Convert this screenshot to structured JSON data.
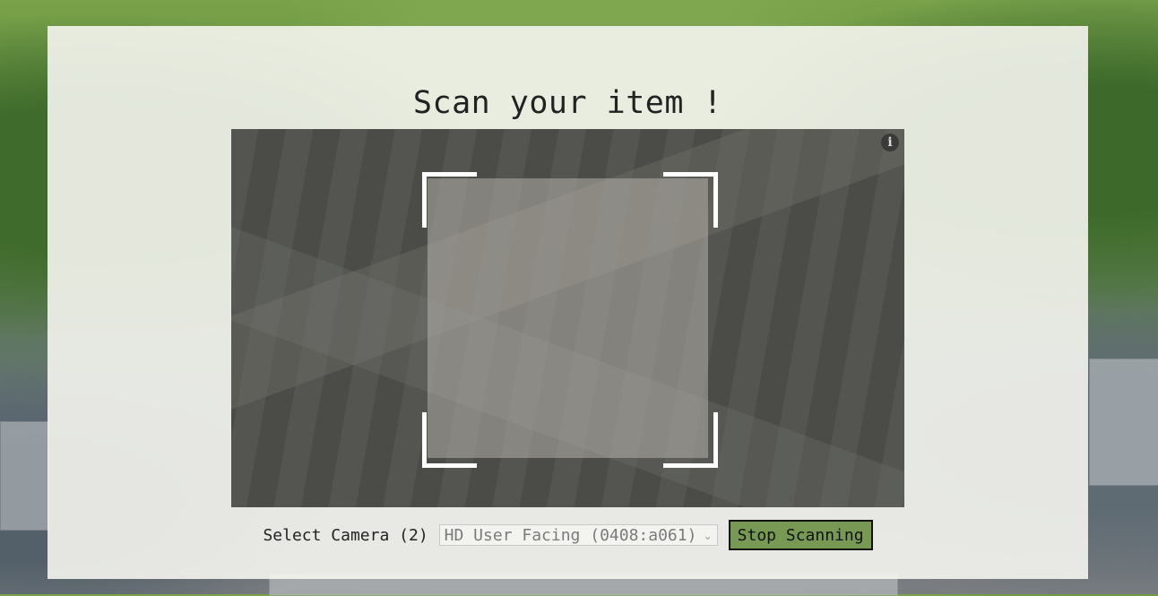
{
  "page": {
    "title": "Scan your item !"
  },
  "scanner": {
    "info_icon": "info-icon",
    "select_label": "Select Camera (2)",
    "camera_value": "HD User Facing (0408:a061)",
    "stop_label": "Stop Scanning"
  },
  "colors": {
    "card_background": "#f5f5f0",
    "viewport_background": "#4e4e4a",
    "scan_corner": "#ffffff",
    "stop_button": "#789954"
  }
}
